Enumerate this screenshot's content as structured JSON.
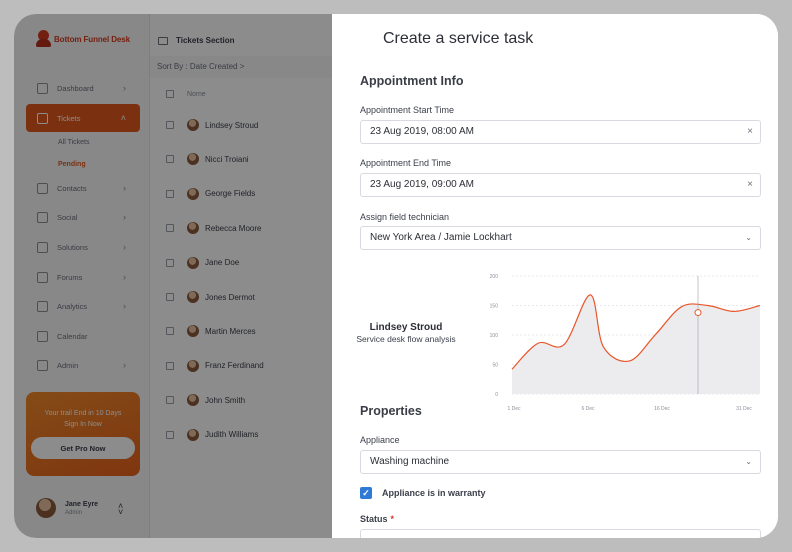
{
  "brand": {
    "name": "Bottom Funnel Desk"
  },
  "sidebar": {
    "items": [
      {
        "label": "Dashboard",
        "icon": "dashboard-icon"
      },
      {
        "label": "Tickets",
        "icon": "ticket-icon",
        "active": true
      },
      {
        "label": "Contacts",
        "icon": "contacts-icon"
      },
      {
        "label": "Social",
        "icon": "social-icon"
      },
      {
        "label": "Solutions",
        "icon": "solutions-icon"
      },
      {
        "label": "Forums",
        "icon": "forums-icon"
      },
      {
        "label": "Analytics",
        "icon": "analytics-icon"
      },
      {
        "label": "Calendar",
        "icon": "calendar-icon"
      },
      {
        "label": "Admin",
        "icon": "admin-icon"
      }
    ],
    "subitems": [
      "All Tickets",
      "Pending"
    ],
    "promo": {
      "line1": "Your trail End in 10 Days",
      "line2": "Sign In Now",
      "button": "Get Pro Now"
    },
    "user": {
      "name": "Jane Eyre",
      "role": "Admin"
    }
  },
  "tickets": {
    "title": "Tickets Section",
    "sort": "Sort By : Date Created >",
    "column": "Nome",
    "rows": [
      "Lindsey Stroud",
      "Nicci Troiani",
      "George Fields",
      "Rebecca Moore",
      "Jane Doe",
      "Jones Dermot",
      "Martin Merces",
      "Franz Ferdinand",
      "John Smith",
      "Judith Williams"
    ]
  },
  "panel": {
    "title": "Create a service task",
    "appointment_title": "Appointment Info",
    "start_label": "Appointment Start Time",
    "start_value": "23 Aug 2019, 08:00 AM",
    "end_label": "Appointment End Time",
    "end_value": "23 Aug 2019, 09:00 AM",
    "tech_label": "Assign field technician",
    "tech_value": "New York Area / Jamie Lockhart",
    "properties_title": "Properties",
    "appliance_label": "Appliance",
    "appliance_value": "Washing machine",
    "warranty_label": "Appliance is in warranty",
    "status_label": "Status",
    "clear_glyph": "×",
    "caret_glyph": "⌄",
    "check_glyph": "✓"
  },
  "chart_data": {
    "type": "area",
    "title": "Lindsey Stroud",
    "subtitle": "Service desk flow analysis",
    "x": [
      0,
      4,
      8,
      12,
      14,
      18,
      22,
      26,
      30,
      34,
      38
    ],
    "x_ticks": [
      "1 Dec",
      "6 Dec",
      "16 Dec",
      "31 Dec"
    ],
    "y": [
      42,
      86,
      84,
      168,
      80,
      56,
      101,
      148,
      150,
      140,
      150
    ],
    "ylim": [
      0,
      200
    ],
    "y_ticks": [
      0,
      50,
      100,
      150,
      200
    ],
    "grid": true,
    "marker": {
      "x": 28.5,
      "y": 138
    },
    "colors": {
      "line": "#e8562a",
      "fill": "#ececee",
      "grid": "#d0d3d9"
    }
  }
}
